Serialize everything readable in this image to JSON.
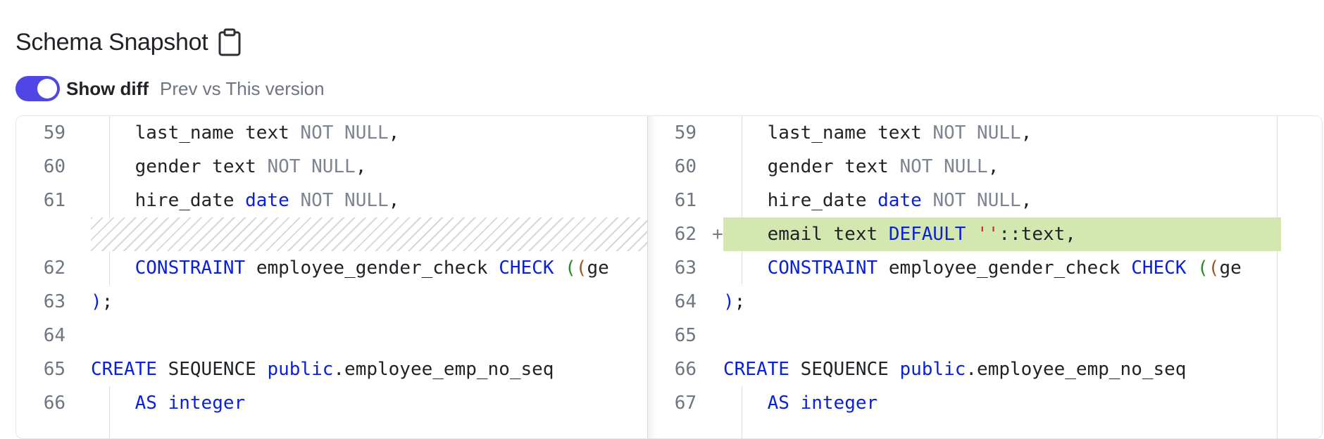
{
  "header": {
    "title": "Schema Snapshot",
    "icon": "clipboard-icon"
  },
  "diff_toggle": {
    "on": true,
    "label": "Show diff",
    "subtitle": "Prev vs This version",
    "accent_color": "#5046e5"
  },
  "colors": {
    "added_line": "#d4e7b1",
    "keyword": "#0a22d4",
    "not_null": "#7c8590",
    "string": "#d8281e"
  },
  "left_pane": {
    "lines": [
      {
        "num": "59",
        "code": "last_name text NOT NULL,"
      },
      {
        "num": "60",
        "code": "gender text NOT NULL,"
      },
      {
        "num": "61",
        "code": "hire_date date NOT NULL,"
      },
      {
        "num": "",
        "code": "",
        "placeholder": true
      },
      {
        "num": "62",
        "code": "CONSTRAINT employee_gender_check CHECK ((ge"
      },
      {
        "num": "63",
        "code": ");"
      },
      {
        "num": "64",
        "code": ""
      },
      {
        "num": "65",
        "code": "CREATE SEQUENCE public.employee_emp_no_seq"
      },
      {
        "num": "66",
        "code": "AS integer"
      }
    ]
  },
  "right_pane": {
    "lines": [
      {
        "num": "59",
        "code": "last_name text NOT NULL,"
      },
      {
        "num": "60",
        "code": "gender text NOT NULL,"
      },
      {
        "num": "61",
        "code": "hire_date date NOT NULL,"
      },
      {
        "num": "62",
        "marker": "+",
        "code": "email text DEFAULT ''::text,",
        "added": true
      },
      {
        "num": "63",
        "code": "CONSTRAINT employee_gender_check CHECK ((ge"
      },
      {
        "num": "64",
        "code": ");"
      },
      {
        "num": "65",
        "code": ""
      },
      {
        "num": "66",
        "code": "CREATE SEQUENCE public.employee_emp_no_seq"
      },
      {
        "num": "67",
        "code": "AS integer"
      }
    ]
  }
}
